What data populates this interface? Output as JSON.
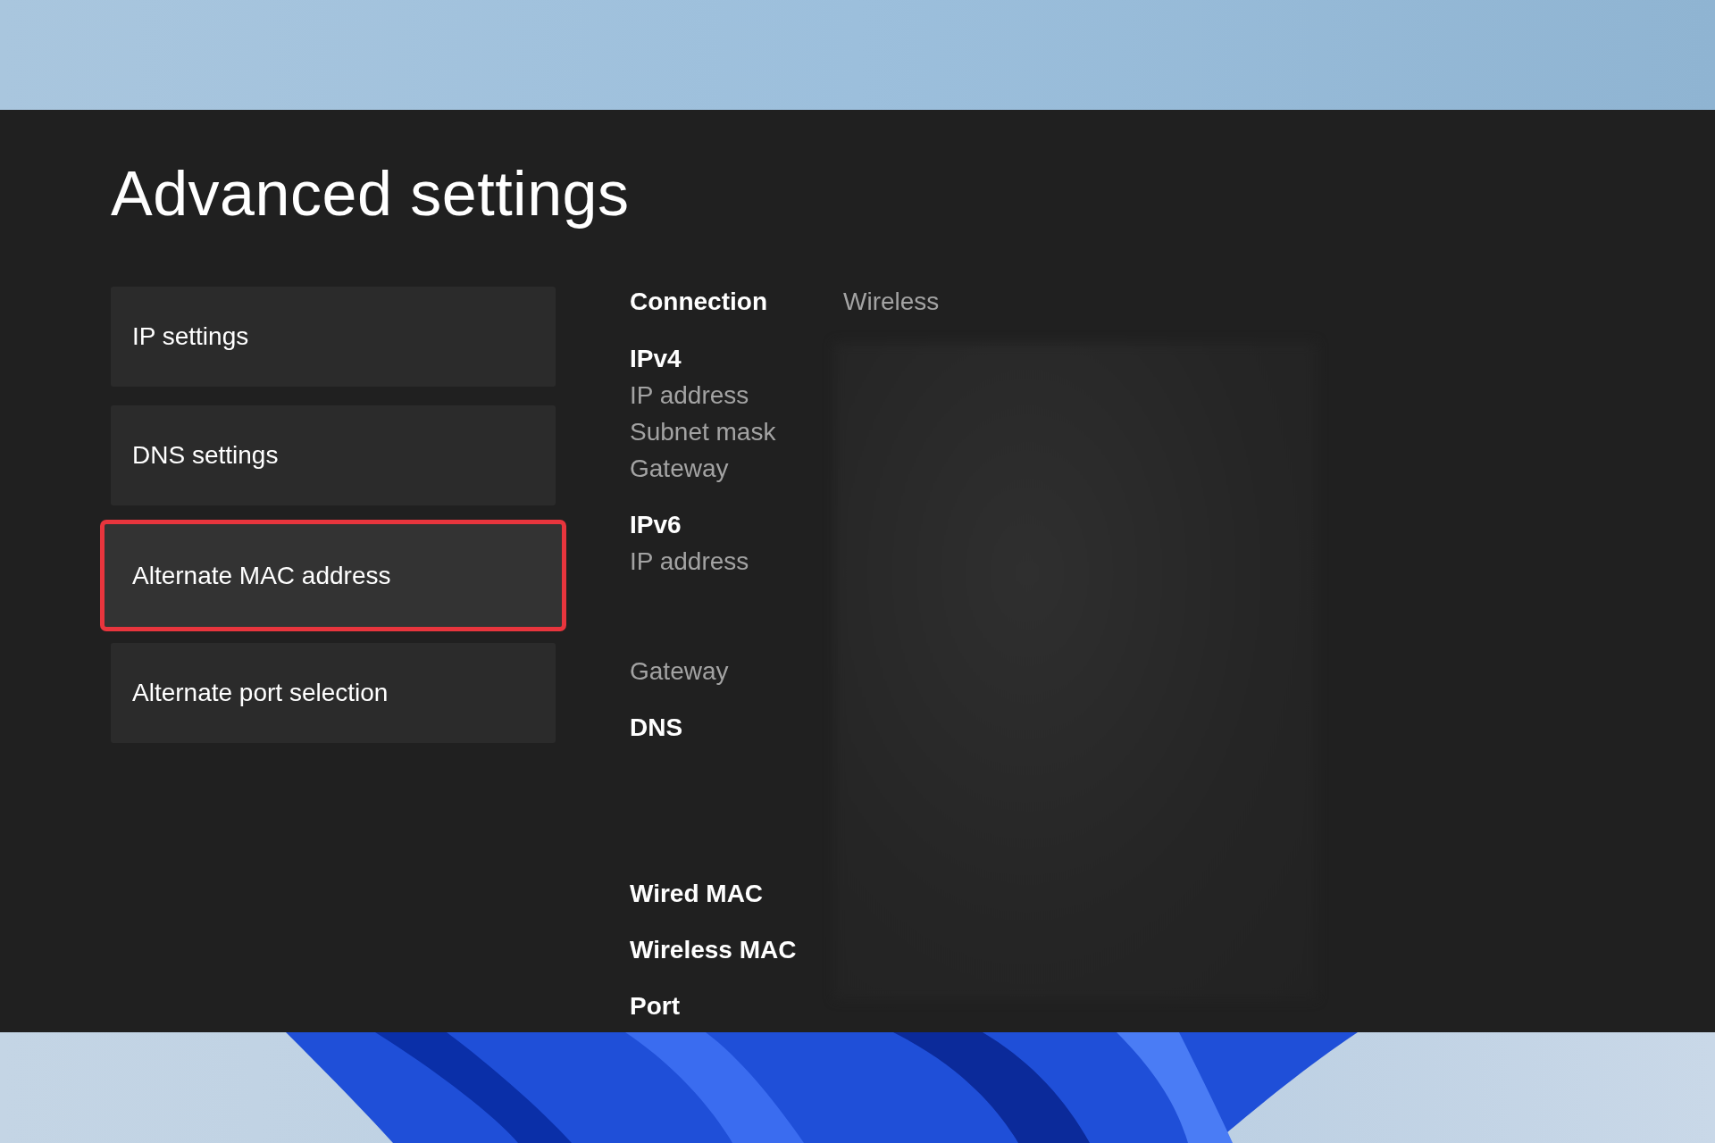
{
  "title": "Advanced settings",
  "menu": [
    {
      "label": "IP settings",
      "selected": false
    },
    {
      "label": "DNS settings",
      "selected": false
    },
    {
      "label": "Alternate MAC address",
      "selected": true
    },
    {
      "label": "Alternate port selection",
      "selected": false
    }
  ],
  "connection": {
    "label": "Connection",
    "value": "Wireless"
  },
  "details": [
    {
      "kind": "heading",
      "label": "IPv4"
    },
    {
      "kind": "field",
      "label": "IP address"
    },
    {
      "kind": "field",
      "label": "Subnet mask"
    },
    {
      "kind": "field",
      "label": "Gateway"
    },
    {
      "kind": "heading",
      "label": "IPv6"
    },
    {
      "kind": "field",
      "label": "IP address"
    },
    {
      "kind": "field",
      "label": "Gateway"
    },
    {
      "kind": "heading",
      "label": "DNS"
    },
    {
      "kind": "heading",
      "label": "Wired MAC"
    },
    {
      "kind": "heading",
      "label": "Wireless MAC"
    },
    {
      "kind": "heading",
      "label": "Port"
    }
  ]
}
